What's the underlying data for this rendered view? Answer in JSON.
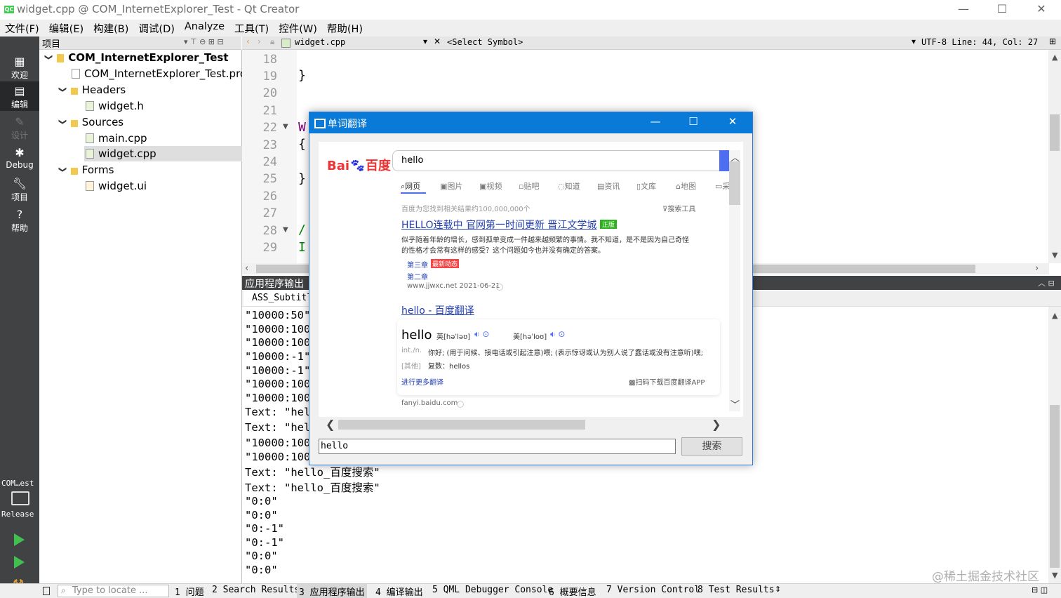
{
  "window": {
    "title": "widget.cpp @ COM_InternetExplorer_Test - Qt Creator",
    "app_icon": "QC",
    "buttons": {
      "minimize": "—",
      "maximize": "☐",
      "close": "✕"
    }
  },
  "menu": [
    "文件(F)",
    "编辑(E)",
    "构建(B)",
    "调试(D)",
    "Analyze",
    "工具(T)",
    "控件(W)",
    "帮助(H)"
  ],
  "modes": [
    {
      "label": "欢迎",
      "icon": "grid-icon"
    },
    {
      "label": "编辑",
      "icon": "edit-icon"
    },
    {
      "label": "设计",
      "icon": "pencil-icon"
    },
    {
      "label": "Debug",
      "icon": "bug-icon"
    },
    {
      "label": "项目",
      "icon": "wrench-icon"
    },
    {
      "label": "帮助",
      "icon": "help-icon"
    }
  ],
  "kit": {
    "project": "COM…est",
    "config": "Release"
  },
  "project_panel": {
    "header": "项目",
    "tree": {
      "root": "COM_InternetExplorer_Test",
      "pro": "COM_InternetExplorer_Test.pro",
      "headers": "Headers",
      "widget_h": "widget.h",
      "sources": "Sources",
      "main_cpp": "main.cpp",
      "widget_cpp": "widget.cpp",
      "forms": "Forms",
      "widget_ui": "widget.ui"
    }
  },
  "editor": {
    "file": "widget.cpp",
    "symbol": "<Select Symbol>",
    "status": "UTF-8 Line: 44, Col: 27",
    "line_numbers": [
      "18",
      "19",
      "20",
      "21",
      "22",
      "23",
      "24",
      "25",
      "26",
      "27",
      "28",
      "29"
    ],
    "code": {
      "l19": "}",
      "l22": "W",
      "l23": "{",
      "l25": "}",
      "l28": "/",
      "l29": "I"
    }
  },
  "output": {
    "header": "应用程序输出",
    "tab": "ASS_Subtitle",
    "lines": [
      "\"10000:50\"",
      "\"10000:100",
      "\"10000:100",
      "\"10000:-1\"",
      "\"10000:-1\"",
      "\"10000:100",
      "\"10000:100",
      "Text: \"hel",
      "Text: \"hel",
      "\"10000:100",
      "\"10000:100",
      "Text: \"hello_百度搜索\"",
      "Text: \"hello_百度搜索\"",
      "\"0:0\"",
      "\"0:0\"",
      "\"0:-1\"",
      "\"0:-1\"",
      "\"0:0\"",
      "\"0:0\""
    ]
  },
  "statusbar": {
    "locate_placeholder": "Type to locate ...",
    "tabs": [
      "1 问题",
      "2 Search Results",
      "3 应用程序输出",
      "4 编译输出",
      "5 QML Debugger Console",
      "6 概要信息",
      "7 Version Control",
      "8 Test Results"
    ]
  },
  "watermark": "@稀土掘金技术社区",
  "dialog": {
    "title": "单词翻译",
    "baidu": {
      "logo_left": "Bai",
      "logo_right": "百度",
      "query": "hello",
      "tabs": [
        "网页",
        "图片",
        "视频",
        "贴吧",
        "知道",
        "资讯",
        "文库",
        "地图",
        "采"
      ],
      "result_count": "百度为您找到相关结果约100,000,000个",
      "tools": "搜索工具",
      "r1_title_a": "HELLO",
      "r1_title_b": "连载中 官网第一时间更新 晋江文学城",
      "r1_badge": "正版",
      "r1_desc1": "似乎随着年龄的增长，感到孤单变成一件越来越频繁的事情。我不知道，是不是因为自己奇怪",
      "r1_desc2": "的性格才会常有这样的感受？这个问题如今也并没有确定的答案。",
      "r1_ch3": "第三章",
      "r1_new": "最新动态",
      "r1_ch2": "第二章",
      "r1_url": "www.jjwxc.net 2021-06-21",
      "r2_title_a": "hello",
      "r2_title_b": " - 百度翻译",
      "r2_word": "hello",
      "r2_uk": "英[həˈləʊ]",
      "r2_us": "美[həˈloʊ]",
      "r2_pos": "int./n.",
      "r2_def": "你好; (用于问候、接电话或引起注意)喂; (表示惊讶或认为别人说了蠢话或没有注意听)嘿;",
      "r2_other_label": "[其他]",
      "r2_other": "复数：hellos",
      "r2_more": "进行更多翻译",
      "r2_app": "扫码下载百度翻译APP",
      "r2_url": "fanyi.baidu.com"
    },
    "input_value": "hello",
    "search_button": "搜索"
  }
}
